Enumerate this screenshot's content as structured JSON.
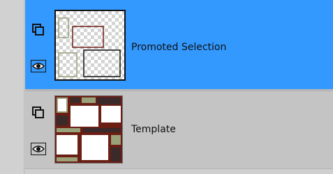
{
  "layers_panel": {
    "layers": [
      {
        "name": "Promoted Selection",
        "selected": true,
        "icons": {
          "mask_toggle": "layer-group-icon",
          "visibility": "eye-icon"
        }
      },
      {
        "name": "Template",
        "selected": false,
        "icons": {
          "mask_toggle": "layer-group-icon",
          "visibility": "eye-icon"
        }
      }
    ]
  },
  "colors": {
    "selection_highlight": "#3399ff",
    "panel_background": "#c4c4c4",
    "template_brown": "#6b1e14",
    "template_sage": "#9aa27a",
    "template_dark": "#3a2a2a"
  }
}
